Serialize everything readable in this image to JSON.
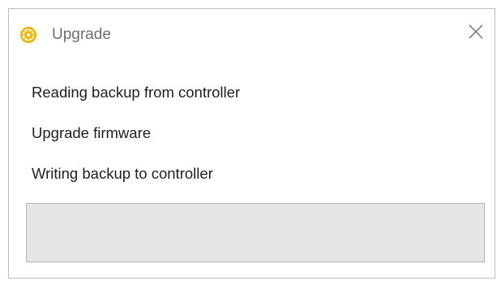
{
  "window": {
    "title": "Upgrade",
    "icon": "gear-icon",
    "accent_color": "#f5b400",
    "close_icon": "close-icon"
  },
  "steps": [
    {
      "label": "Reading backup from controller"
    },
    {
      "label": "Upgrade firmware"
    },
    {
      "label": "Writing backup to controller"
    }
  ],
  "progress": {
    "value": 0
  }
}
